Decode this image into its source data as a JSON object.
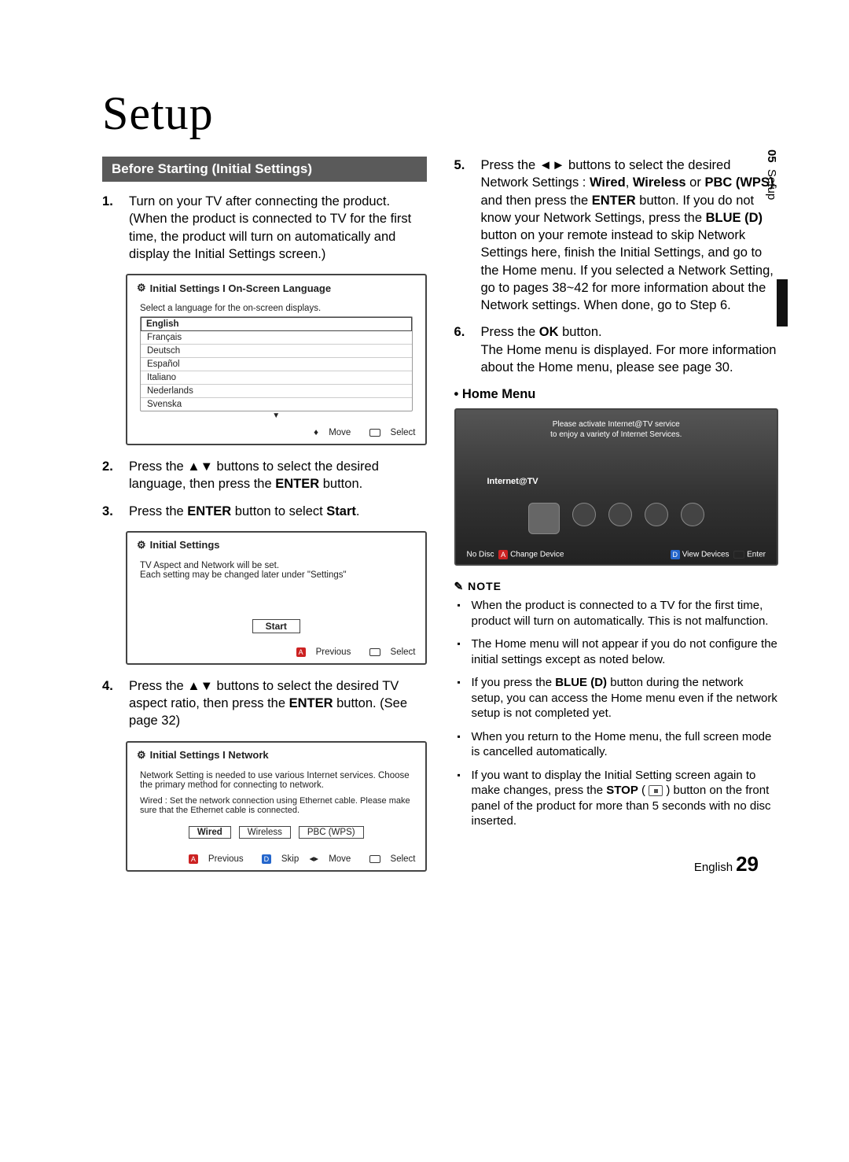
{
  "page": {
    "title": "Setup",
    "language": "English",
    "number": "29",
    "side_chapter": "05",
    "side_label": "Setup"
  },
  "header": {
    "section": "Before Starting (Initial Settings)"
  },
  "steps_left": {
    "s1": "Turn on your TV after connecting the product. (When the product is connected to TV for the first time, the product will turn on automatically and display the Initial Settings screen.)",
    "s2_a": "Press the ▲▼ buttons to select the desired language, then press the ",
    "s2_b": "ENTER",
    "s2_c": " button.",
    "s3_a": "Press the ",
    "s3_b": "ENTER",
    "s3_c": " button to select ",
    "s3_d": "Start",
    "s3_e": ".",
    "s4_a": "Press the ▲▼ buttons to select the desired TV aspect ratio, then press the ",
    "s4_b": "ENTER",
    "s4_c": " button. (See page 32)"
  },
  "steps_right": {
    "s5_a": "Press the ◄► buttons to select the desired Network Settings : ",
    "s5_b": "Wired",
    "s5_c": ", ",
    "s5_d": "Wireless",
    "s5_e": " or ",
    "s5_f": "PBC (WPS)",
    "s5_g": ", and then press the ",
    "s5_h": "ENTER",
    "s5_i": " button. If you do not know your Network Settings, press the ",
    "s5_j": "BLUE (D)",
    "s5_k": " button on your remote instead to skip Network Settings here, finish the Initial Settings, and go to the Home menu. If you selected a Network Setting, go to pages 38~42 for more information about the Network settings. When done, go to Step 6.",
    "s6_a": "Press the ",
    "s6_b": "OK",
    "s6_c": " button.",
    "s6_d": "The Home menu is displayed. For more information about the Home menu, please see page 30."
  },
  "home_label": "Home Menu",
  "panel_lang": {
    "title": "Initial Settings I On-Screen Language",
    "prompt": "Select a language for the on-screen displays.",
    "items": [
      "English",
      "Français",
      "Deutsch",
      "Español",
      "Italiano",
      "Nederlands",
      "Svenska"
    ],
    "foot_move": "Move",
    "foot_select": "Select"
  },
  "panel_start": {
    "title": "Initial Settings",
    "line1": "TV Aspect and Network will be set.",
    "line2": "Each setting may be changed later under \"Settings\"",
    "btn": "Start",
    "foot_prev": "Previous",
    "foot_select": "Select"
  },
  "panel_net": {
    "title": "Initial Settings I Network",
    "line1": "Network Setting is needed to use various Internet services. Choose the primary method for connecting to network.",
    "line2": "Wired : Set the network connection using Ethernet cable. Please make sure that the Ethernet cable is connected.",
    "btns": [
      "Wired",
      "Wireless",
      "PBC (WPS)"
    ],
    "foot_prev": "Previous",
    "foot_skip": "Skip",
    "foot_move": "Move",
    "foot_select": "Select"
  },
  "panel_home": {
    "top1": "Please activate Internet@TV service",
    "top2": "to enjoy a variety of Internet Services.",
    "label": "Internet@TV",
    "foot_left": "No Disc",
    "foot_change": "Change Device",
    "foot_view": "View Devices",
    "foot_enter": "Enter"
  },
  "notes": {
    "hdr": "NOTE",
    "n1": "When the product is connected to a TV for the first time, product will turn on automatically. This is not malfunction.",
    "n2": "The Home menu will not appear if you do not configure the initial settings except as noted below.",
    "n3_a": "If you press the ",
    "n3_b": "BLUE (D)",
    "n3_c": " button during the network setup, you can access the Home menu even if the network setup is not completed yet.",
    "n4": "When you return to the Home menu, the full screen mode is cancelled automatically.",
    "n5_a": "If you want to display the Initial Setting screen again to make changes, press the ",
    "n5_b": "STOP",
    "n5_c": " ( ",
    "n5_d": " ) button on the front panel of the product for more than 5 seconds with no disc inserted."
  }
}
